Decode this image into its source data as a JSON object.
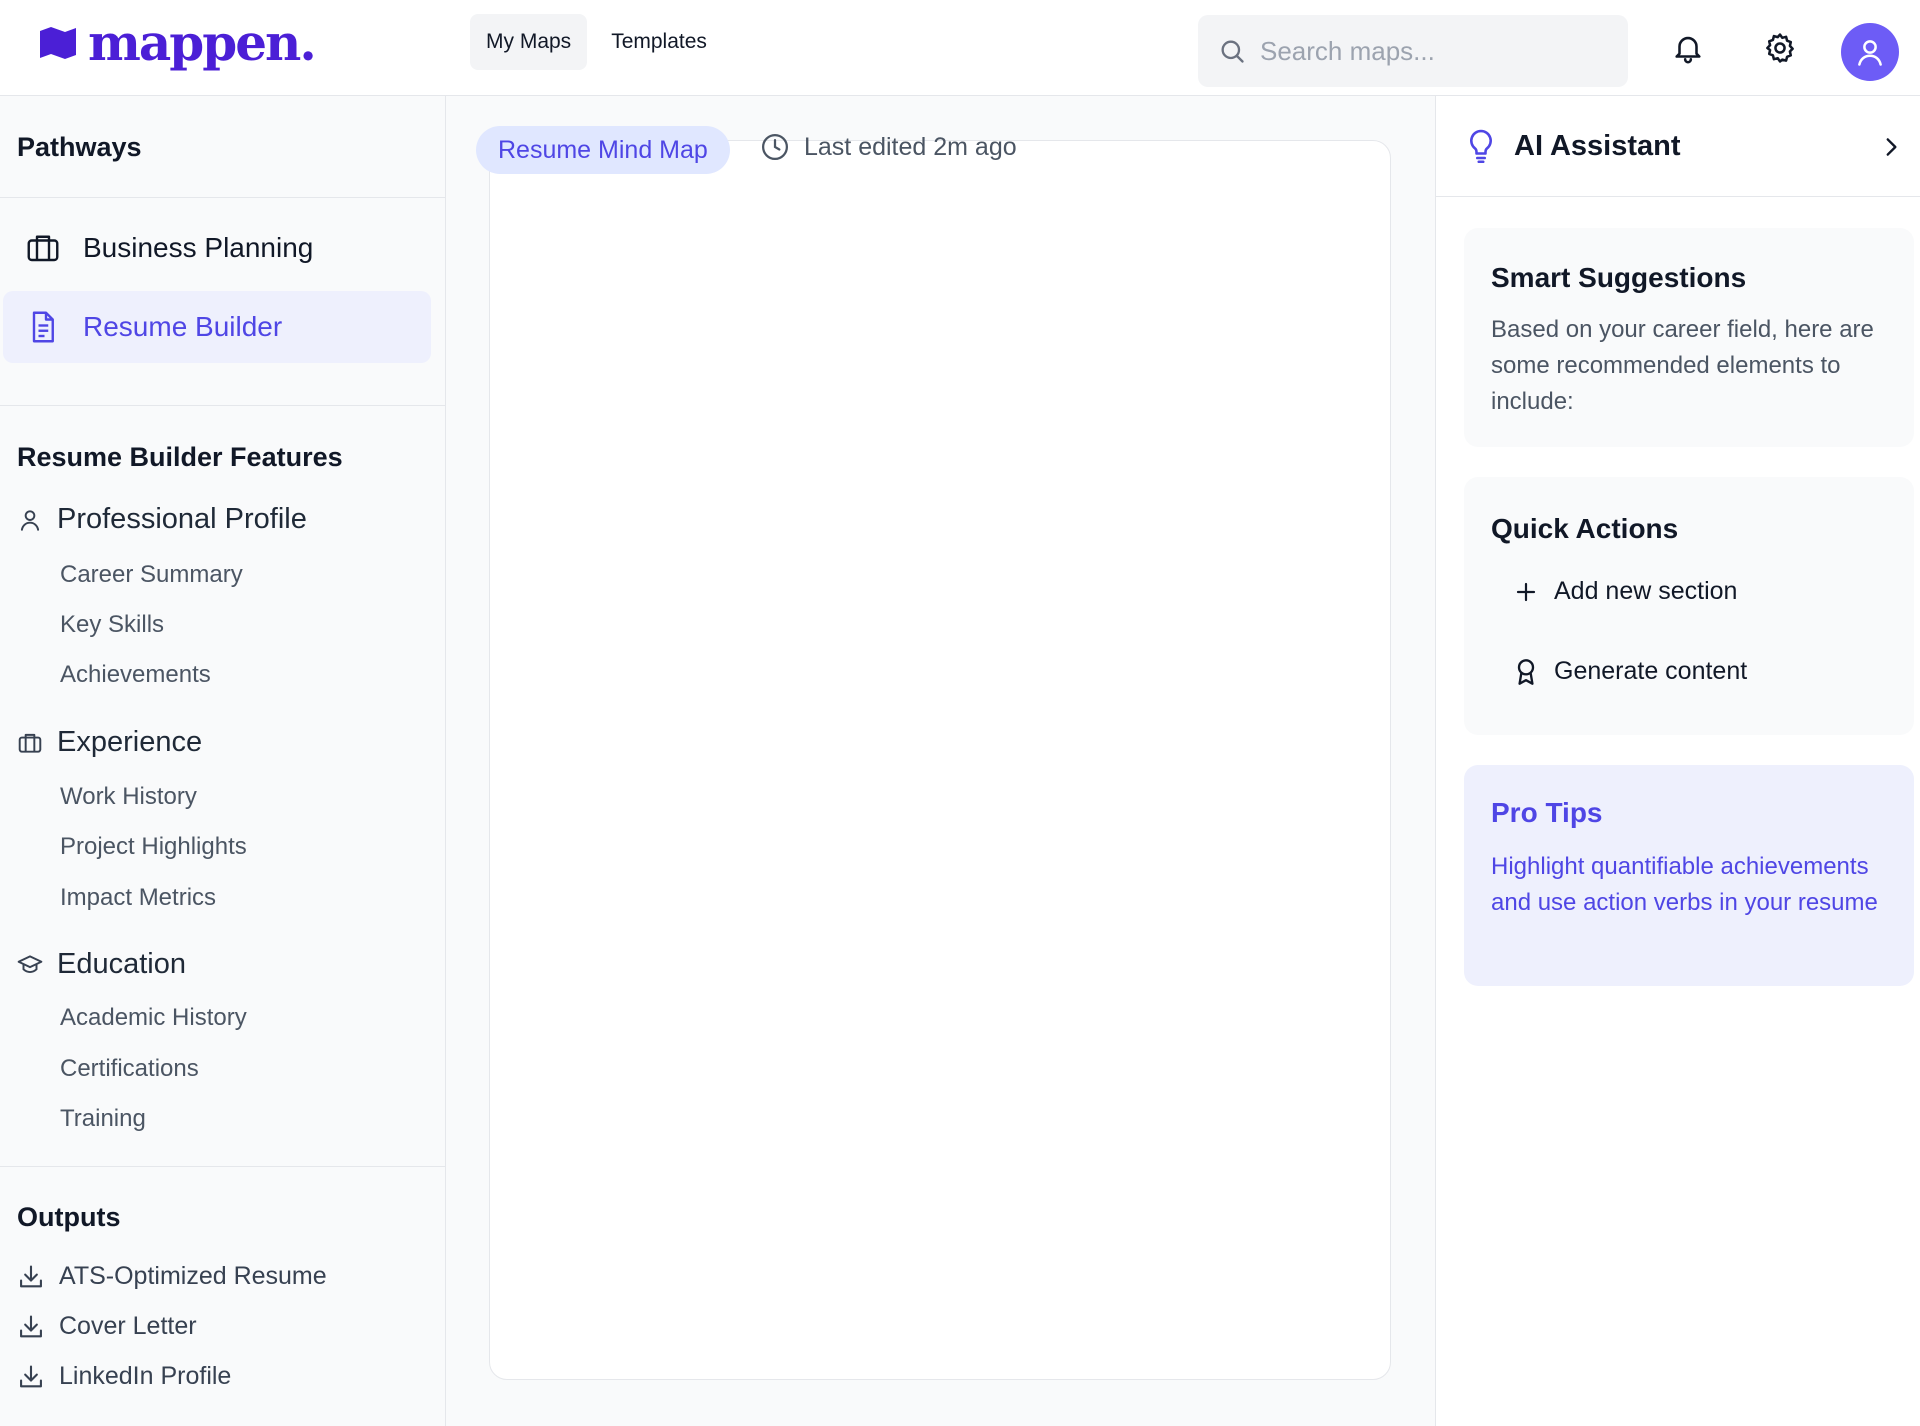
{
  "app": {
    "logo_text": "mappen."
  },
  "nav": {
    "tabs": [
      {
        "label": "My Maps"
      },
      {
        "label": "Templates"
      }
    ]
  },
  "search": {
    "placeholder": "Search maps..."
  },
  "sidebar": {
    "pathways_title": "Pathways",
    "pathways": [
      {
        "label": "Business Planning",
        "icon": "briefcase-icon"
      },
      {
        "label": "Resume Builder",
        "icon": "document-icon"
      }
    ],
    "features_title": "Resume Builder Features",
    "features": [
      {
        "label": "Professional Profile",
        "icon": "user-icon",
        "items": [
          "Career Summary",
          "Key Skills",
          "Achievements"
        ]
      },
      {
        "label": "Experience",
        "icon": "briefcase-icon",
        "items": [
          "Work History",
          "Project Highlights",
          "Impact Metrics"
        ]
      },
      {
        "label": "Education",
        "icon": "graduation-cap-icon",
        "items": [
          "Academic History",
          "Certifications",
          "Training"
        ]
      }
    ],
    "outputs_title": "Outputs",
    "outputs": [
      {
        "label": "ATS-Optimized Resume"
      },
      {
        "label": "Cover Letter"
      },
      {
        "label": "LinkedIn Profile"
      }
    ]
  },
  "main": {
    "map_title": "Resume Mind Map",
    "last_edited": "Last edited 2m ago"
  },
  "assistant": {
    "title": "AI Assistant",
    "smart_title": "Smart Suggestions",
    "smart_text": "Based on your career field, here are some recommended elements to include:",
    "quick_title": "Quick Actions",
    "quick_actions": [
      {
        "label": "Add new section",
        "icon": "plus-icon"
      },
      {
        "label": "Generate content",
        "icon": "award-icon"
      }
    ],
    "tips_title": "Pro Tips",
    "tips_text": "Highlight quantifiable achievements and use action verbs in your resume"
  },
  "colors": {
    "brand": "#4b1fd6",
    "accent": "#4f46e5",
    "accent_soft": "#eef0fd",
    "avatar": "#6d5cf6"
  }
}
